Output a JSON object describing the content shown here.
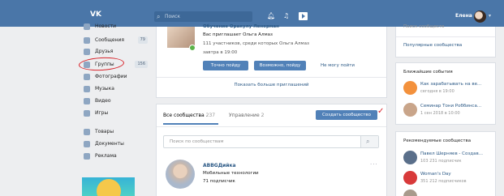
{
  "header": {
    "logo": "VK",
    "search_placeholder": "Поиск",
    "user_name": "Елена"
  },
  "sidebar": {
    "items": [
      {
        "label": "Новости",
        "count": ""
      },
      {
        "label": "Сообщения",
        "count": "79"
      },
      {
        "label": "Друзья",
        "count": ""
      },
      {
        "label": "Группы",
        "count": "156"
      },
      {
        "label": "Фотографии",
        "count": ""
      },
      {
        "label": "Музыка",
        "count": ""
      },
      {
        "label": "Видео",
        "count": ""
      },
      {
        "label": "Игры",
        "count": ""
      },
      {
        "label": "Товары",
        "count": ""
      },
      {
        "label": "Документы",
        "count": ""
      },
      {
        "label": "Реклама",
        "count": ""
      }
    ]
  },
  "invitation": {
    "title": "Обучение Оракулу Ленорман",
    "invited_by": "Вас приглашает Ольга Алмаз",
    "members": "111 участников, среди которых Ольга Алмаз",
    "time": "завтра в 19:00",
    "btn_going": "Точно пойду",
    "btn_maybe": "Возможно, пойду",
    "btn_not_going": "Не могу пойти",
    "show_more": "Показать больше приглашений"
  },
  "communities": {
    "tab_all_label": "Все сообщества",
    "tab_all_count": "237",
    "tab_manage_label": "Управление",
    "tab_manage_count": "2",
    "create_button": "Создать сообщество",
    "search_placeholder": "Поиск по сообществам",
    "group": {
      "name": "ABBGДийка",
      "category": "Мобильные технологии",
      "subscribers": "71 подписчик"
    }
  },
  "right": {
    "top_links": [
      "Поиск сообществ",
      "Популярные сообщества"
    ],
    "events_title": "Ближайшие события",
    "events": [
      {
        "name": "Как зарабатывать на ве...",
        "date": "сегодня в 19:00"
      },
      {
        "name": "Семинар Тони Роббинса...",
        "date": "1 сен 2018 в 10:00"
      }
    ],
    "recommended_title": "Рекомендуемые сообщества",
    "recommended": [
      {
        "name": "Павел Шерняев - Создав...",
        "subs": "103 231 подписчик"
      },
      {
        "name": "Woman's Day",
        "subs": "351 212 подписчиков"
      },
      {
        "name": "",
        "subs": ""
      }
    ]
  },
  "colors": {
    "header": "#4a76a8",
    "accent": "#5181b8",
    "link": "#2a5885",
    "annotation": "#d8232a"
  }
}
